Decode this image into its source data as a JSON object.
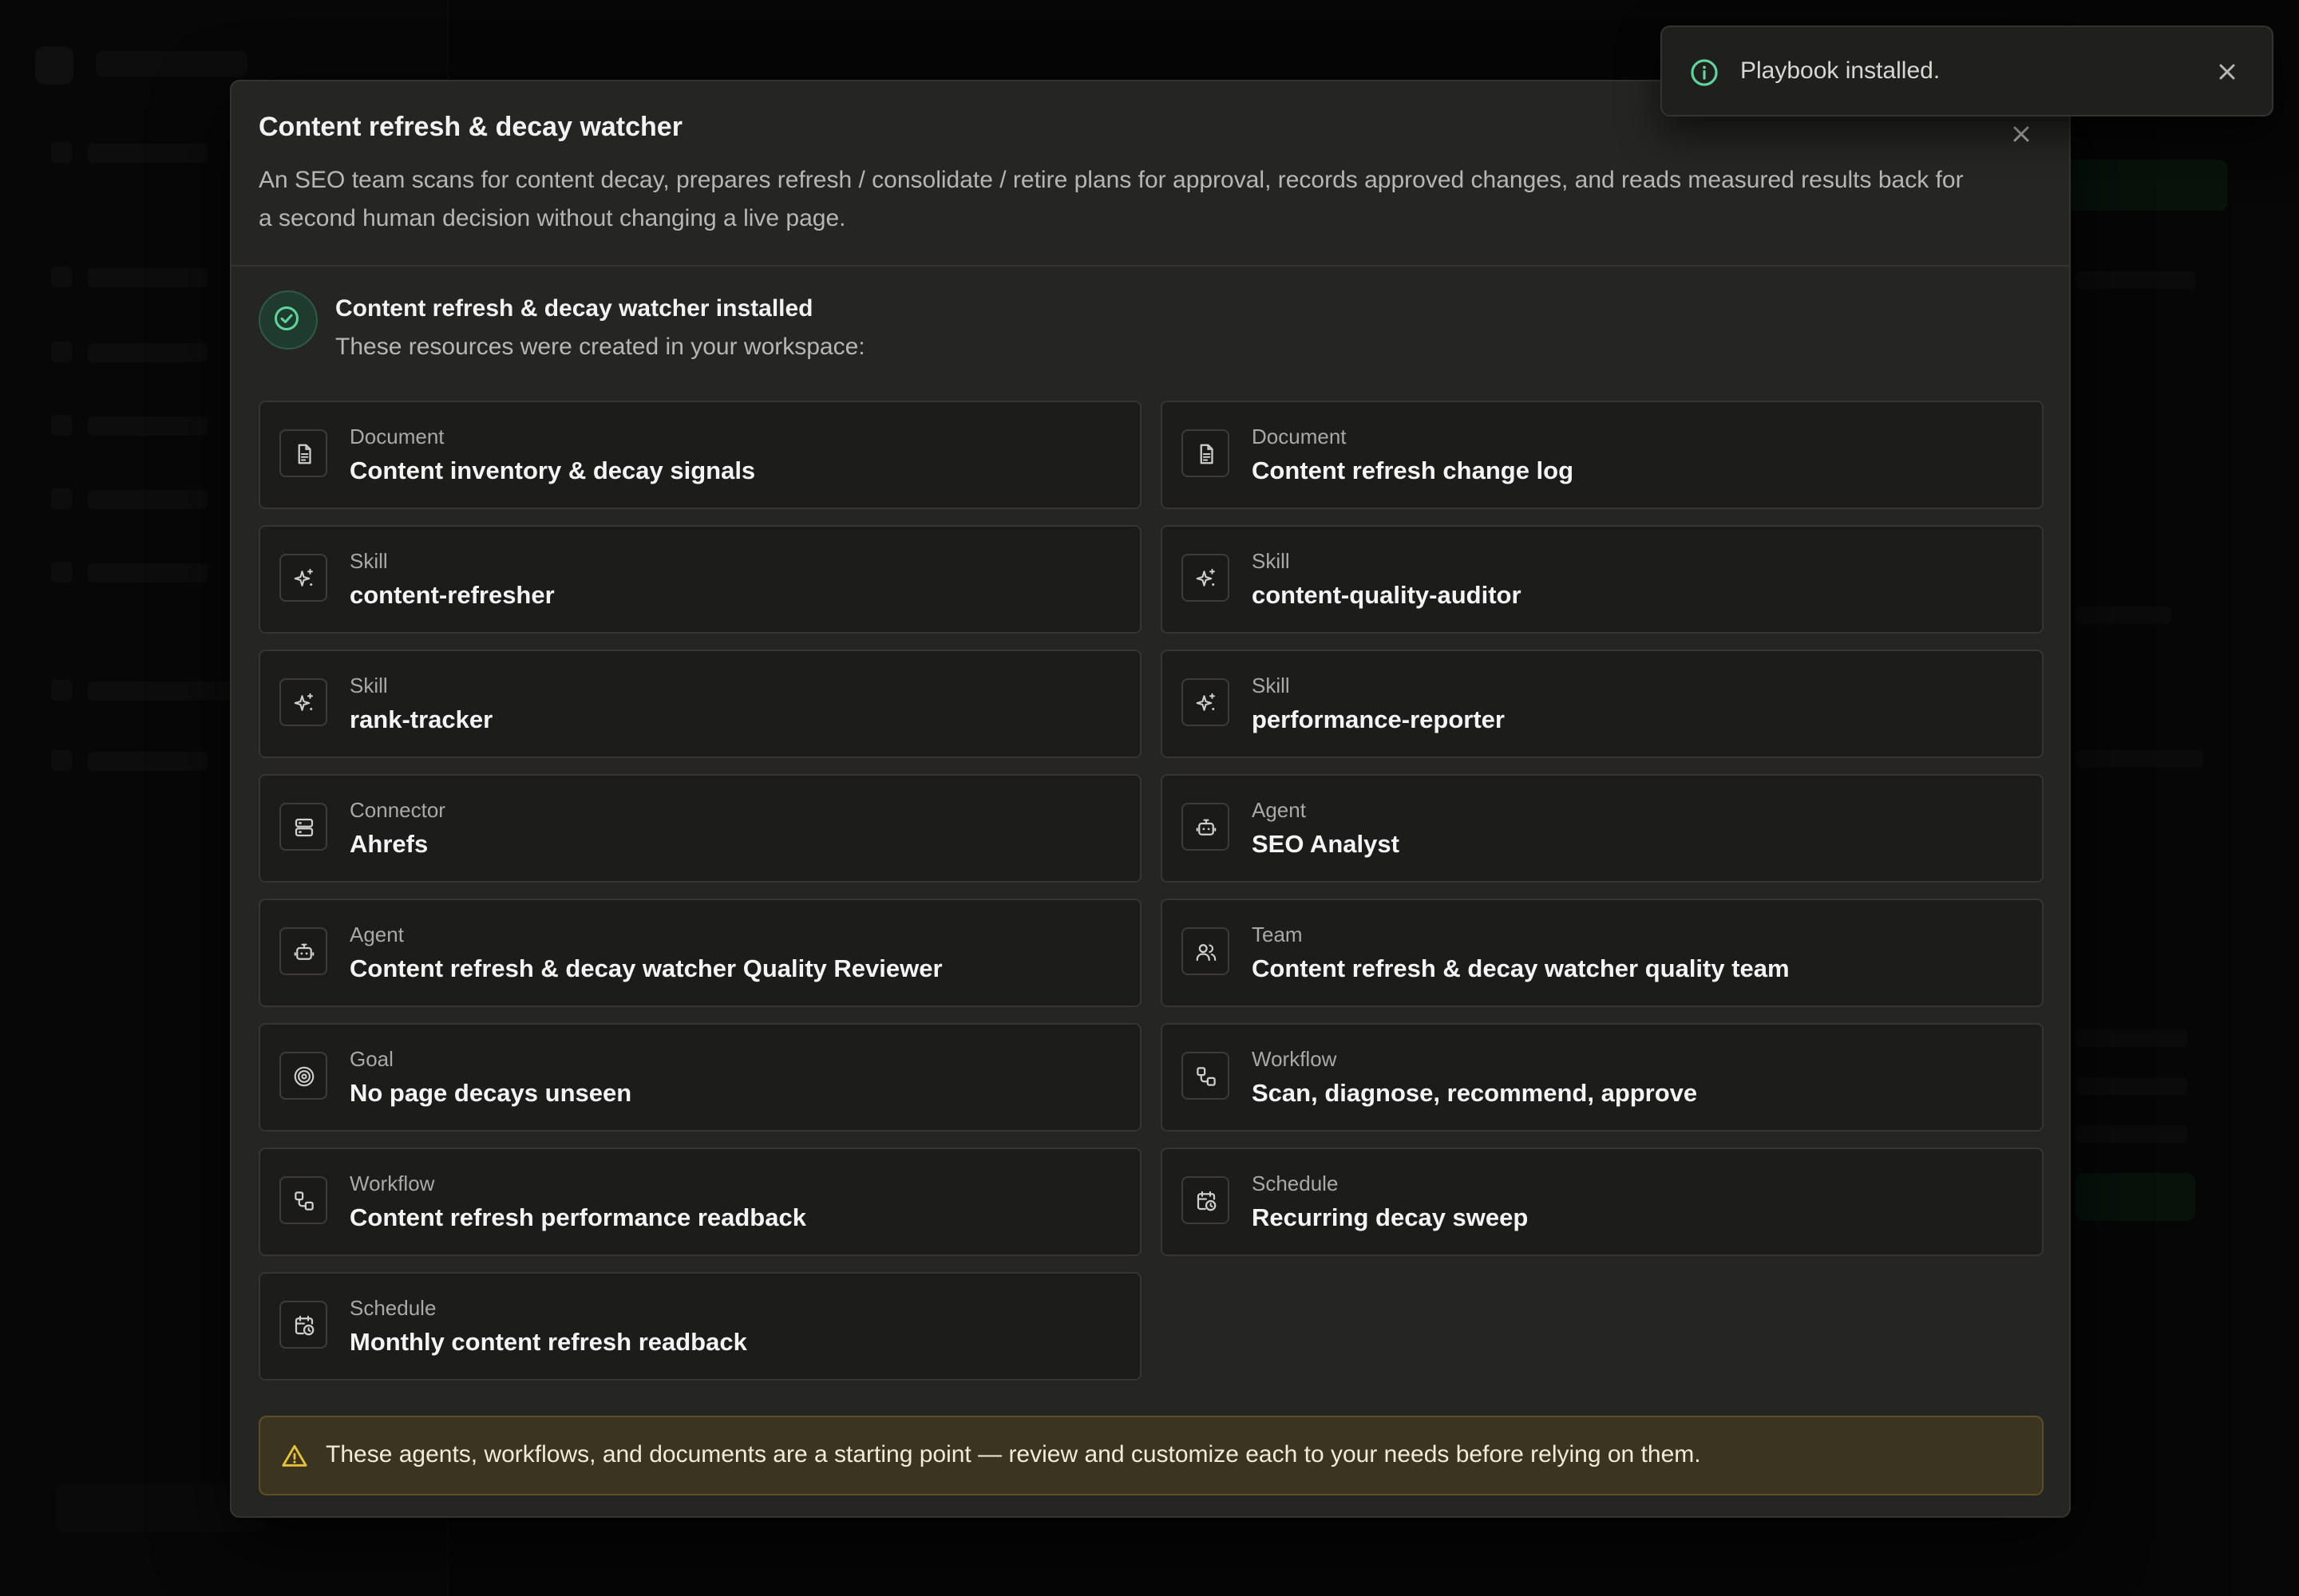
{
  "modal": {
    "title": "Content refresh & decay watcher",
    "description": "An SEO team scans for content decay, prepares refresh / consolidate / retire plans for approval, records approved changes, and reads measured results back for a second human decision without changing a live page.",
    "close_icon": "close-icon"
  },
  "success": {
    "icon": "check-circle-icon",
    "title": "Content refresh & decay watcher installed",
    "subtitle": "These resources were created in your workspace:"
  },
  "resources": [
    {
      "type": "Document",
      "name": "Content inventory & decay signals",
      "icon": "document-icon"
    },
    {
      "type": "Document",
      "name": "Content refresh change log",
      "icon": "document-icon"
    },
    {
      "type": "Skill",
      "name": "content-refresher",
      "icon": "sparkles-icon"
    },
    {
      "type": "Skill",
      "name": "content-quality-auditor",
      "icon": "sparkles-icon"
    },
    {
      "type": "Skill",
      "name": "rank-tracker",
      "icon": "sparkles-icon"
    },
    {
      "type": "Skill",
      "name": "performance-reporter",
      "icon": "sparkles-icon"
    },
    {
      "type": "Connector",
      "name": "Ahrefs",
      "icon": "server-icon"
    },
    {
      "type": "Agent",
      "name": "SEO Analyst",
      "icon": "bot-icon"
    },
    {
      "type": "Agent",
      "name": "Content refresh & decay watcher Quality Reviewer",
      "icon": "bot-icon"
    },
    {
      "type": "Team",
      "name": "Content refresh & decay watcher quality team",
      "icon": "users-icon"
    },
    {
      "type": "Goal",
      "name": "No page decays unseen",
      "icon": "target-icon"
    },
    {
      "type": "Workflow",
      "name": "Scan, diagnose, recommend, approve",
      "icon": "workflow-icon"
    },
    {
      "type": "Workflow",
      "name": "Content refresh performance readback",
      "icon": "workflow-icon"
    },
    {
      "type": "Schedule",
      "name": "Recurring decay sweep",
      "icon": "calendar-clock-icon"
    },
    {
      "type": "Schedule",
      "name": "Monthly content refresh readback",
      "icon": "calendar-clock-icon"
    }
  ],
  "warning": {
    "icon": "warning-triangle-icon",
    "text": "These agents, workflows, and documents are a starting point — review and customize each to your needs before relying on them."
  },
  "toast": {
    "icon": "info-circle-icon",
    "message": "Playbook installed.",
    "close_icon": "close-icon"
  },
  "colors": {
    "modal_bg": "#252523",
    "card_bg": "#1c1c1b",
    "success_accent": "#5fd59a",
    "warning_bg": "#3a3420",
    "warning_accent": "#e8c23a"
  }
}
